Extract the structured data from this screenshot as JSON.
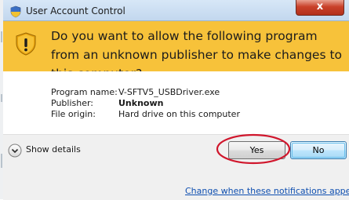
{
  "window": {
    "title": "User Account Control",
    "close_glyph": "x"
  },
  "header": {
    "icon": "warning-shield-icon",
    "question": "Do you want to allow the following program from an unknown publisher to make changes to this computer?"
  },
  "details": [
    {
      "label": "Program name:",
      "value": "V-SFTV5_USBDriver.exe",
      "bold": false
    },
    {
      "label": "Publisher:",
      "value": "Unknown",
      "bold": true
    },
    {
      "label": "File origin:",
      "value": "Hard drive on this computer",
      "bold": false
    }
  ],
  "footer": {
    "show_details_label": "Show details",
    "yes_label": "Yes",
    "no_label": "No",
    "notifications_link": "Change when these notifications appear"
  },
  "colors": {
    "header_bg": "#f7c23a",
    "highlight_ellipse": "#d0162c",
    "link": "#0f4fb0"
  }
}
